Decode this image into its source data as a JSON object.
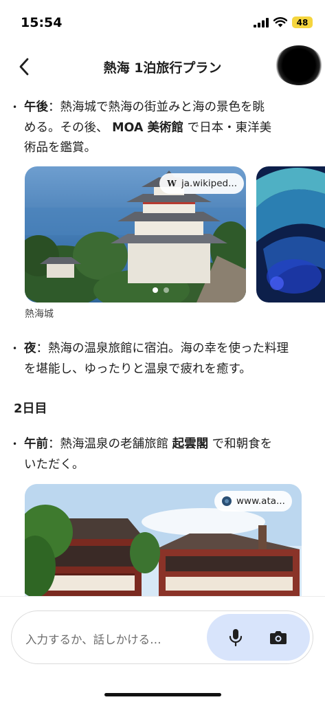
{
  "status": {
    "time": "15:54",
    "battery": "48"
  },
  "header": {
    "title": "熱海 1泊旅行プラン"
  },
  "afternoon": {
    "label": "午後",
    "text1": "：熱海城で熱海の街並みと海の景色を眺",
    "text2a": "める。その後、",
    "museum": "MOA 美術館",
    "text2b": "で日本・東洋美",
    "text3": "術品を鑑賞。"
  },
  "carousel1": {
    "chip_icon": "W",
    "chip_text": "ja.wikiped...",
    "caption": "熱海城"
  },
  "night": {
    "label": "夜",
    "text1": "：熱海の温泉旅館に宿泊。海の幸を使った料理",
    "text2": "を堪能し、ゆったりと温泉で疲れを癒す。"
  },
  "day2": {
    "heading": "2日目"
  },
  "morning": {
    "label": "午前",
    "text1a": "：熱海温泉の老舗旅館",
    "ryokan": "起雲閣",
    "text1b": "で和朝食を",
    "text2": "いただく。"
  },
  "carousel2": {
    "chip_text": "www.ata..."
  },
  "input": {
    "placeholder": "入力するか、話しかける…"
  },
  "icons": {
    "back": "chevron-left-icon",
    "wiki": "wikipedia-icon",
    "site": "site-favicon-icon",
    "mic": "microphone-icon",
    "camera": "camera-icon"
  },
  "colors": {
    "voice_group_bg": "#d8e4fb",
    "battery_bg": "#f5d53e"
  }
}
